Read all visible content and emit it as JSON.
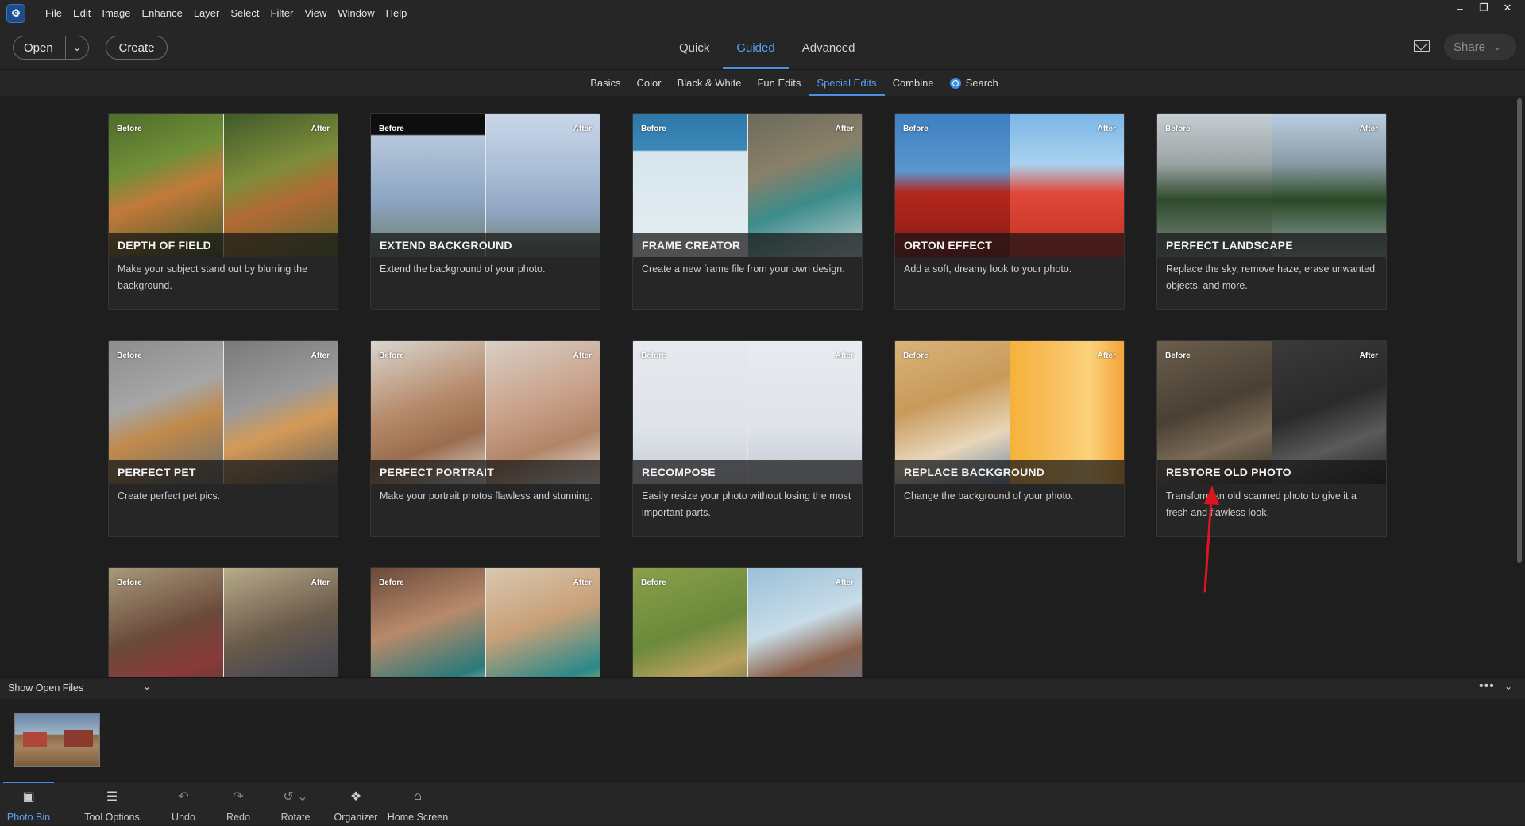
{
  "app": {
    "logo_glyph": "⚙"
  },
  "menus": [
    "File",
    "Edit",
    "Image",
    "Enhance",
    "Layer",
    "Select",
    "Filter",
    "View",
    "Window",
    "Help"
  ],
  "window_controls": {
    "minimize": "–",
    "restore": "❐",
    "close": "✕"
  },
  "toolbar": {
    "open_label": "Open",
    "open_chevron": "⌄",
    "create_label": "Create",
    "share_label": "Share",
    "share_chevron": "⌄"
  },
  "mode_tabs": [
    {
      "label": "Quick",
      "active": false
    },
    {
      "label": "Guided",
      "active": true
    },
    {
      "label": "Advanced",
      "active": false
    }
  ],
  "sub_tabs": [
    {
      "label": "Basics",
      "active": false
    },
    {
      "label": "Color",
      "active": false
    },
    {
      "label": "Black & White",
      "active": false
    },
    {
      "label": "Fun Edits",
      "active": false
    },
    {
      "label": "Special Edits",
      "active": true
    },
    {
      "label": "Combine",
      "active": false
    },
    {
      "label": "Search",
      "active": false
    }
  ],
  "before_label": "Before",
  "after_label": "After",
  "cards": [
    {
      "title": "DEPTH OF FIELD",
      "desc": "Make your subject stand out by blurring the background.",
      "before_bg": "linear-gradient(160deg,#4f6b2a 0%,#6f8f38 35%,#c27a3a 55%,#3e5a26 100%)",
      "after_bg": "linear-gradient(160deg,#3f5a2a 0%,#7e8d3a 40%,#b26a34 60%,#556b30 100%)"
    },
    {
      "title": "EXTEND BACKGROUND",
      "desc": "Extend the background of your photo.",
      "before_bg": "linear-gradient(180deg,#0e0e0e 0%,#0e0e0e 14%,#b7c7dc 15%,#8ca5c4 60%,#6e7e6a 100%)",
      "after_bg": "linear-gradient(180deg,#c9d6e8 0%,#a9bdd6 40%,#8fa4c0 70%,#6d7c66 100%)"
    },
    {
      "title": "FRAME CREATOR",
      "desc": "Create a new frame file from your own design.",
      "before_bg": "linear-gradient(180deg,#2f78a8 0%,#3b88b8 25%,#d6e6ee 26%,#e6eef2 100%)",
      "after_bg": "linear-gradient(160deg,#6b6a5c 0%,#8a8068 35%,#3c8c8a 60%,#c4d0d6 100%)"
    },
    {
      "title": "ORTON EFFECT",
      "desc": "Add a soft, dreamy look to your photo.",
      "before_bg": "linear-gradient(180deg,#3d7fc0 0%,#5a97cf 40%,#b3271e 55%,#8a1a14 100%)",
      "after_bg": "linear-gradient(180deg,#7bb6e6 0%,#a9d2f0 35%,#e0483a 55%,#c33024 100%)"
    },
    {
      "title": "PERFECT LANDSCAPE",
      "desc": "Replace the sky, remove haze, erase unwanted objects, and more.",
      "before_bg": "linear-gradient(180deg,#c6cdd2 0%,#9aa3a4 35%,#2e4a2c 60%,#7a8a80 100%)",
      "after_bg": "linear-gradient(180deg,#b7cde0 0%,#8a9aa4 35%,#2a4a26 60%,#8f9fa2 100%)"
    },
    {
      "title": "PERFECT PET",
      "desc": "Create perfect pet pics.",
      "before_bg": "linear-gradient(160deg,#8d8d8d 0%,#a6a6a6 40%,#c08a4a 60%,#6e6e6e 100%)",
      "after_bg": "linear-gradient(160deg,#7a7a7a 0%,#9a9a9a 40%,#d49a56 60%,#5e5e5e 100%)"
    },
    {
      "title": "PERFECT PORTRAIT",
      "desc": "Make your portrait photos flawless and stunning.",
      "before_bg": "linear-gradient(160deg,#d9d6cf 0%,#b58a6a 45%,#9a6d4e 70%,#dcd8d0 100%)",
      "after_bg": "linear-gradient(160deg,#d8cfc6 0%,#c9a088 45%,#b08568 70%,#e8e3dc 100%)"
    },
    {
      "title": "RECOMPOSE",
      "desc": "Easily resize your photo without losing the most important parts.",
      "before_bg": "linear-gradient(180deg,#e6e9ee 0%,#dfe3ea 60%,#c8ccd4 100%)",
      "after_bg": "linear-gradient(180deg,#e8ebf0 0%,#dfe3ea 60%,#c4c9d2 100%)"
    },
    {
      "title": "REPLACE BACKGROUND",
      "desc": "Change the background of your photo.",
      "before_bg": "linear-gradient(160deg,#d9b37a 0%,#c89a5a 40%,#e8d6b8 70%,#6f8aa8 100%)",
      "after_bg": "linear-gradient(90deg,#f6b13a 0%,#f8c060 40%,#fbd27a 70%,#f4a23a 100%)"
    },
    {
      "title": "RESTORE OLD PHOTO",
      "desc": "Transform an old scanned photo to give it a fresh and flawless look.",
      "before_bg": "linear-gradient(160deg,#6a5d4c 0%,#4a4034 45%,#7a6a56 70%,#3a332a 100%)",
      "after_bg": "linear-gradient(160deg,#3a3a3a 0%,#2a2a2a 45%,#5a5a5a 70%,#222222 100%)"
    },
    {
      "title": "",
      "desc": "",
      "before_bg": "linear-gradient(160deg,#a89a7a 0%,#6a4a3a 45%,#8a3a3a 70%,#4a3a30 100%)",
      "after_bg": "linear-gradient(160deg,#b8ac8a 0%,#6a5a4a 45%,#4a4a50 70%,#3a3a3a 100%)"
    },
    {
      "title": "",
      "desc": "",
      "before_bg": "linear-gradient(160deg,#6a4a3a 0%,#b88a6a 40%,#2a7a7a 75%,#e8e2d6 100%)",
      "after_bg": "linear-gradient(160deg,#d8c8b0 0%,#c8a078 40%,#2a8a8a 75%,#e4c84a 100%)"
    },
    {
      "title": "",
      "desc": "",
      "before_bg": "linear-gradient(160deg,#8aa04a 0%,#6a8a3a 45%,#b8a060 70%,#4a6a2a 100%)",
      "after_bg": "linear-gradient(160deg,#9ac0d8 0%,#c8dce8 40%,#8a6048 65%,#5a7aa0 100%)"
    }
  ],
  "photo_bin": {
    "show_open_files": "Show Open Files",
    "chevron": "⌄",
    "more": "•••"
  },
  "bottom_bar": [
    {
      "label": "Photo Bin",
      "icon": "photo-bin-icon",
      "glyph": "▣",
      "active": true
    },
    {
      "label": "Tool Options",
      "icon": "tool-options-icon",
      "glyph": "☰",
      "active": false
    },
    {
      "label": "Undo",
      "icon": "undo-icon",
      "glyph": "↶",
      "active": false,
      "dim": true
    },
    {
      "label": "Redo",
      "icon": "redo-icon",
      "glyph": "↷",
      "active": false,
      "dim": true
    },
    {
      "label": "Rotate",
      "icon": "rotate-icon",
      "glyph": "↺ ⌄",
      "active": false,
      "dim": true
    },
    {
      "label": "Organizer",
      "icon": "organizer-icon",
      "glyph": "❖",
      "active": false
    },
    {
      "label": "Home Screen",
      "icon": "home-icon",
      "glyph": "⌂",
      "active": false
    }
  ],
  "colors": {
    "accent": "#4a90e2",
    "annotation": "#e0141e"
  }
}
